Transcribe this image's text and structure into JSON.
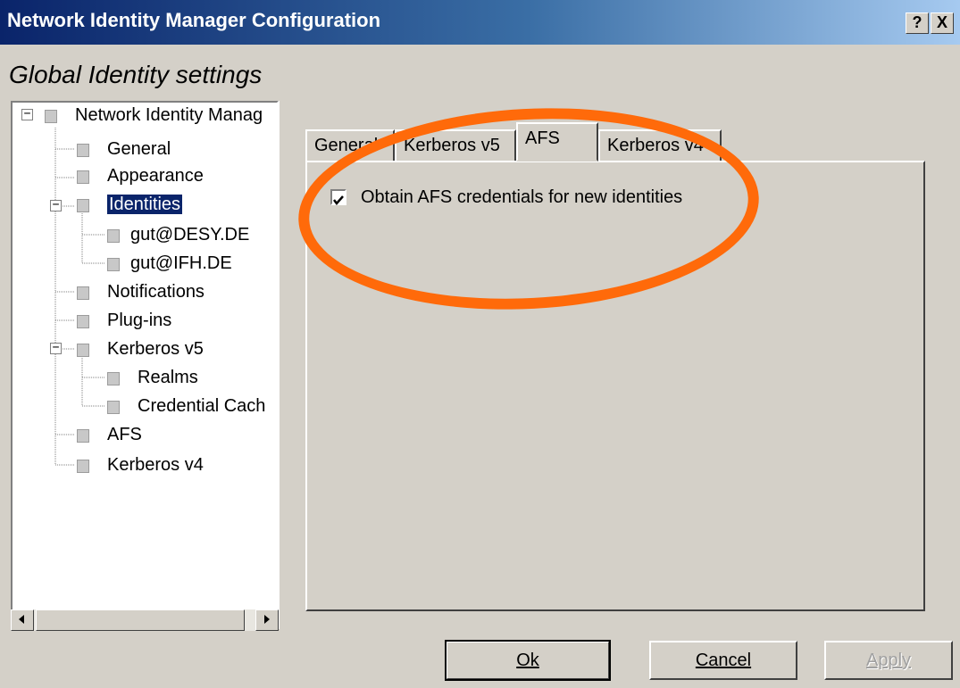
{
  "window": {
    "title": "Network Identity Manager Configuration",
    "help_button": "?",
    "close_button": "X"
  },
  "header": {
    "title": "Global Identity settings"
  },
  "tree": {
    "root": "Network Identity Manag",
    "general": "General",
    "appearance": "Appearance",
    "identities": "Identities",
    "identity_1": "gut@DESY.DE",
    "identity_2": "gut@IFH.DE",
    "notifications": "Notifications",
    "plugins": "Plug-ins",
    "kerberos_v5": "Kerberos v5",
    "realms": "Realms",
    "credential_cache": "Credential Cach",
    "afs": "AFS",
    "kerberos_v4": "Kerberos v4"
  },
  "tabs": {
    "general": "General",
    "kerberos_v5": "Kerberos v5",
    "afs": "AFS",
    "kerberos_v4": "Kerberos v4",
    "active": "AFS"
  },
  "afs_page": {
    "obtain_afs_label": "Obtain AFS credentials for new identities",
    "obtain_afs_checked": true
  },
  "buttons": {
    "ok": "Ok",
    "cancel": "Cancel",
    "apply": "Apply"
  },
  "colors": {
    "highlight_ellipse": "#ff6a0a",
    "selection": "#0a246a"
  }
}
